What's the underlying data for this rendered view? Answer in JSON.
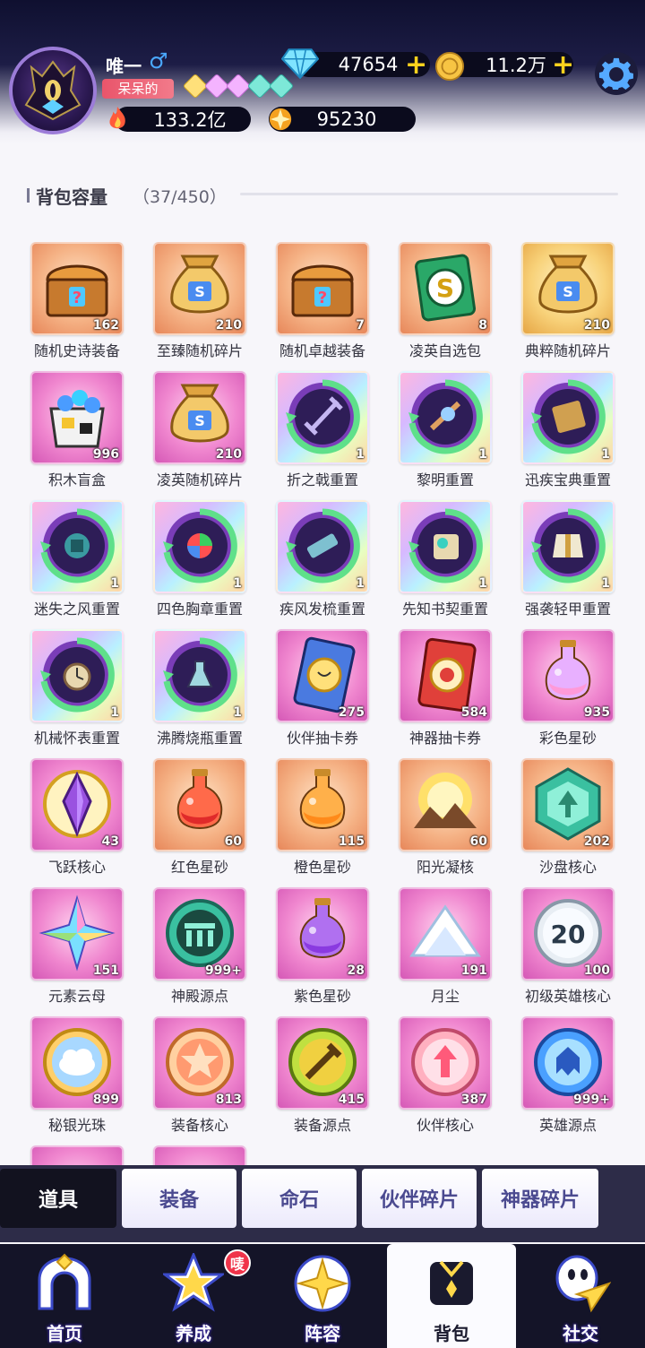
{
  "player": {
    "name": "唯一",
    "gender_symbol": "♂",
    "title": "呆呆的",
    "power": "133.2亿",
    "stars": "95230"
  },
  "currency": {
    "diamonds": "47654",
    "gold": "11.2万",
    "plus": "+"
  },
  "bag": {
    "capacity_label": "背包容量",
    "capacity_count": "（37/450）"
  },
  "items": [
    {
      "name": "随机史诗装备",
      "qty": "162",
      "bg": "orange",
      "icon": "chest-icon"
    },
    {
      "name": "至臻随机碎片",
      "qty": "210",
      "bg": "orange",
      "icon": "money-bag-icon"
    },
    {
      "name": "随机卓越装备",
      "qty": "7",
      "bg": "orange",
      "icon": "chest-icon"
    },
    {
      "name": "凌英自选包",
      "qty": "8",
      "bg": "orange",
      "icon": "coin-card-icon"
    },
    {
      "name": "典粹随机碎片",
      "qty": "210",
      "bg": "gold",
      "icon": "money-bag-icon"
    },
    {
      "name": "积木盲盒",
      "qty": "996",
      "bg": "pink",
      "icon": "block-box-icon"
    },
    {
      "name": "凌英随机碎片",
      "qty": "210",
      "bg": "pink",
      "icon": "money-bag-icon"
    },
    {
      "name": "折之戟重置",
      "qty": "1",
      "bg": "rainbow",
      "icon": "reset-halberd-icon"
    },
    {
      "name": "黎明重置",
      "qty": "1",
      "bg": "rainbow",
      "icon": "reset-dawn-icon"
    },
    {
      "name": "迅疾宝典重置",
      "qty": "1",
      "bg": "rainbow",
      "icon": "reset-book-icon"
    },
    {
      "name": "迷失之风重置",
      "qty": "1",
      "bg": "rainbow",
      "icon": "reset-wind-icon"
    },
    {
      "name": "四色胸章重置",
      "qty": "1",
      "bg": "rainbow",
      "icon": "reset-badge-icon"
    },
    {
      "name": "疾风发梳重置",
      "qty": "1",
      "bg": "rainbow",
      "icon": "reset-comb-icon"
    },
    {
      "name": "先知书契重置",
      "qty": "1",
      "bg": "rainbow",
      "icon": "reset-scroll-icon"
    },
    {
      "name": "强袭轻甲重置",
      "qty": "1",
      "bg": "rainbow",
      "icon": "reset-armor-icon"
    },
    {
      "name": "机械怀表重置",
      "qty": "1",
      "bg": "rainbow",
      "icon": "reset-watch-icon"
    },
    {
      "name": "沸腾烧瓶重置",
      "qty": "1",
      "bg": "rainbow",
      "icon": "reset-flask-icon"
    },
    {
      "name": "伙伴抽卡券",
      "qty": "275",
      "bg": "pink",
      "icon": "partner-card-icon"
    },
    {
      "name": "神器抽卡券",
      "qty": "584",
      "bg": "pink",
      "icon": "artifact-card-icon"
    },
    {
      "name": "彩色星砂",
      "qty": "935",
      "bg": "pink",
      "icon": "rainbow-potion-icon"
    },
    {
      "name": "飞跃核心",
      "qty": "43",
      "bg": "pink",
      "icon": "crystal-core-icon"
    },
    {
      "name": "红色星砂",
      "qty": "60",
      "bg": "orange",
      "icon": "red-potion-icon"
    },
    {
      "name": "橙色星砂",
      "qty": "115",
      "bg": "orange",
      "icon": "orange-potion-icon"
    },
    {
      "name": "阳光凝核",
      "qty": "60",
      "bg": "orange",
      "icon": "sun-orb-icon"
    },
    {
      "name": "沙盘核心",
      "qty": "202",
      "bg": "orange",
      "icon": "hex-core-icon"
    },
    {
      "name": "元素云母",
      "qty": "151",
      "bg": "pink",
      "icon": "mica-star-icon"
    },
    {
      "name": "神殿源点",
      "qty": "999+",
      "bg": "pink",
      "icon": "temple-orb-icon"
    },
    {
      "name": "紫色星砂",
      "qty": "28",
      "bg": "pink",
      "icon": "purple-potion-icon"
    },
    {
      "name": "月尘",
      "qty": "191",
      "bg": "pink",
      "icon": "moon-dust-icon"
    },
    {
      "name": "初级英雄核心",
      "qty": "100",
      "bg": "pink",
      "icon": "number-coin-icon",
      "coin_number": "20"
    },
    {
      "name": "秘银光珠",
      "qty": "899",
      "bg": "pink",
      "icon": "cloud-orb-icon"
    },
    {
      "name": "装备核心",
      "qty": "813",
      "bg": "pink",
      "icon": "gear-core-icon"
    },
    {
      "name": "装备源点",
      "qty": "415",
      "bg": "pink",
      "icon": "sword-orb-icon"
    },
    {
      "name": "伙伴核心",
      "qty": "387",
      "bg": "pink",
      "icon": "partner-core-icon"
    },
    {
      "name": "英雄源点",
      "qty": "999+",
      "bg": "pink",
      "icon": "hero-orb-icon"
    }
  ],
  "category_tabs": [
    {
      "label": "道具",
      "active": true
    },
    {
      "label": "装备",
      "active": false
    },
    {
      "label": "命石",
      "active": false
    },
    {
      "label": "伙伴碎片",
      "active": false
    },
    {
      "label": "神器碎片",
      "active": false
    }
  ],
  "nav": [
    {
      "label": "首页",
      "icon": "home-gate-icon",
      "active": false
    },
    {
      "label": "养成",
      "icon": "star-train-icon",
      "active": false,
      "badge": "唛"
    },
    {
      "label": "阵容",
      "icon": "lineup-icon",
      "active": false
    },
    {
      "label": "背包",
      "icon": "backpack-icon",
      "active": true
    },
    {
      "label": "社交",
      "icon": "social-icon",
      "active": false
    }
  ],
  "colors": {
    "accent_gold": "#ffd21d",
    "title_badge": "#e9556b",
    "tab_text": "#4b4a90",
    "header_dark": "#0f1030"
  }
}
